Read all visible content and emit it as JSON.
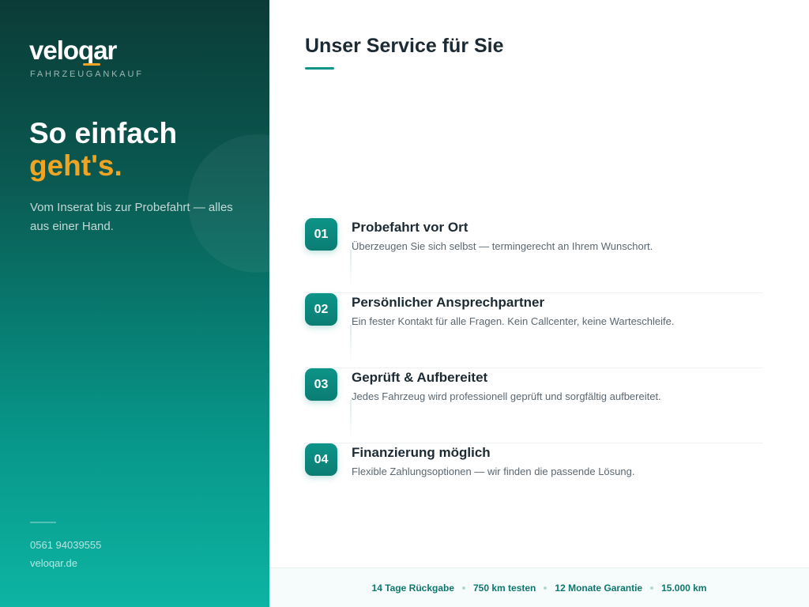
{
  "brand": {
    "logo": "veloqar",
    "tagline": "FAHRZEUGANKAUF"
  },
  "hero": {
    "headline_line1": "So einfach",
    "headline_line2": "geht's.",
    "intro": "Vom Inserat bis zur Probefahrt — alles aus einer Hand."
  },
  "contact": {
    "phone": "0561 94039555",
    "website": "veloqar.de"
  },
  "main": {
    "title": "Unser Service für Sie",
    "services": [
      {
        "number": "01",
        "title": "Probefahrt vor Ort",
        "description": "Überzeugen Sie sich selbst — termingerecht an Ihrem Wunschort."
      },
      {
        "number": "02",
        "title": "Persönlicher Ansprechpartner",
        "description": "Ein fester Kontakt für alle Fragen. Kein Callcenter, keine Warteschleife."
      },
      {
        "number": "03",
        "title": "Geprüft & Aufbereitet",
        "description": "Jedes Fahrzeug wird professionell geprüft und sorgfältig aufbereitet."
      },
      {
        "number": "04",
        "title": "Finanzierung möglich",
        "description": "Flexible Zahlungsoptionen — wir finden die passende Lösung."
      }
    ]
  },
  "footer": {
    "items": [
      "14 Tage Rückgabe",
      "750 km testen",
      "12 Monate Garantie",
      "15.000 km"
    ]
  },
  "colors": {
    "accent": "#f0a424",
    "primary": "#0d9488",
    "dark": "#0b3b37"
  }
}
